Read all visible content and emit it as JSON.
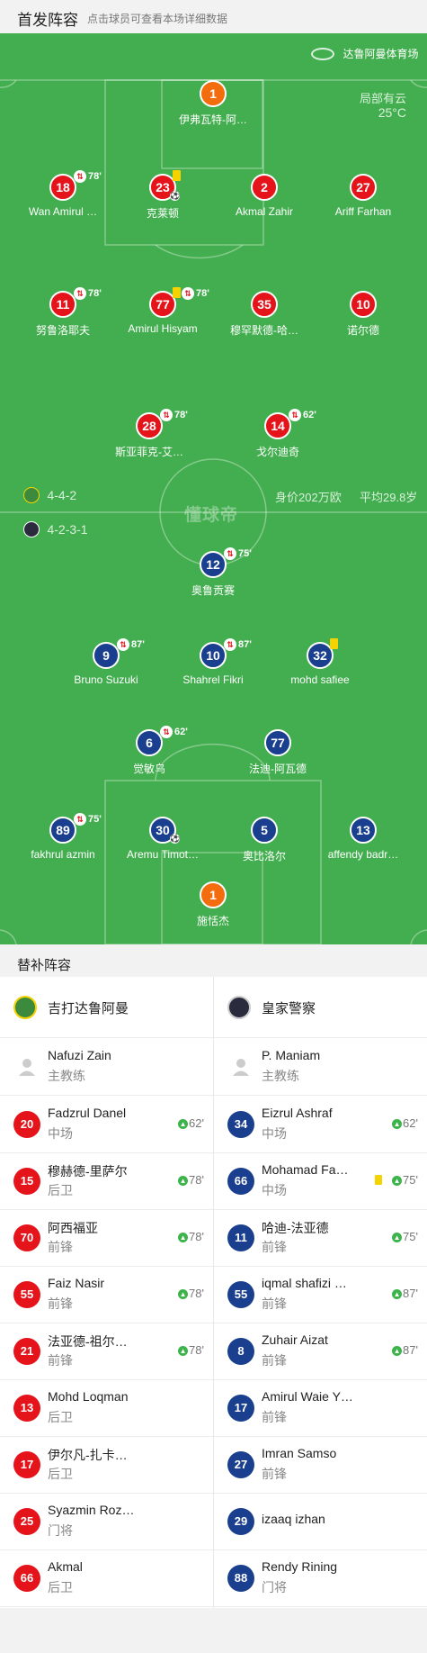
{
  "header": {
    "title": "首发阵容",
    "subtitle": "点击球员可查看本场详细数据"
  },
  "pitch": {
    "stadium": "达鲁阿曼体育场",
    "weather": "局部有云",
    "temperature": "25°C",
    "watermark": "懂球帝",
    "home_formation": "4-4-2",
    "away_formation": "4-2-3-1",
    "market_value": "身价202万欧",
    "avg_age": "平均29.8岁"
  },
  "home_lineup": [
    {
      "number": "1",
      "name": "伊弗瓦特-阿…",
      "role": "gk",
      "sub": "",
      "ycard": false,
      "goal": false
    },
    {
      "number": "18",
      "name": "Wan Amirul …",
      "role": "field",
      "sub": "78'",
      "ycard": false,
      "goal": false
    },
    {
      "number": "23",
      "name": "克莱顿",
      "role": "field",
      "sub": "",
      "ycard": true,
      "goal": true
    },
    {
      "number": "2",
      "name": "Akmal Zahir",
      "role": "field",
      "sub": "",
      "ycard": false,
      "goal": false
    },
    {
      "number": "27",
      "name": "Ariff Farhan",
      "role": "field",
      "sub": "",
      "ycard": false,
      "goal": false
    },
    {
      "number": "11",
      "name": "努鲁洛耶夫",
      "role": "field",
      "sub": "78'",
      "ycard": false,
      "goal": false
    },
    {
      "number": "77",
      "name": "Amirul Hisyam",
      "role": "field",
      "sub": "78'",
      "ycard": true,
      "goal": false
    },
    {
      "number": "35",
      "name": "穆罕默德-哈…",
      "role": "field",
      "sub": "",
      "ycard": false,
      "goal": false
    },
    {
      "number": "10",
      "name": "诺尔德",
      "role": "field",
      "sub": "",
      "ycard": false,
      "goal": false
    },
    {
      "number": "28",
      "name": "斯亚菲克-艾…",
      "role": "field",
      "sub": "78'",
      "ycard": false,
      "goal": false
    },
    {
      "number": "14",
      "name": "戈尔迪奇",
      "role": "field",
      "sub": "62'",
      "ycard": false,
      "goal": false
    }
  ],
  "away_lineup": [
    {
      "number": "12",
      "name": "奥鲁贡赛",
      "role": "field",
      "sub": "75'",
      "ycard": false,
      "goal": false
    },
    {
      "number": "9",
      "name": "Bruno Suzuki",
      "role": "field",
      "sub": "87'",
      "ycard": false,
      "goal": false
    },
    {
      "number": "10",
      "name": "Shahrel Fikri",
      "role": "field",
      "sub": "87'",
      "ycard": false,
      "goal": false
    },
    {
      "number": "32",
      "name": "mohd safiee",
      "role": "field",
      "sub": "",
      "ycard": true,
      "goal": false
    },
    {
      "number": "6",
      "name": "觉敏乌",
      "role": "field",
      "sub": "62'",
      "ycard": false,
      "goal": false
    },
    {
      "number": "77",
      "name": "法迪-阿瓦德",
      "role": "field",
      "sub": "",
      "ycard": false,
      "goal": false
    },
    {
      "number": "89",
      "name": "fakhrul azmin",
      "role": "field",
      "sub": "75'",
      "ycard": false,
      "goal": false
    },
    {
      "number": "30",
      "name": "Aremu Timot…",
      "role": "field",
      "sub": "",
      "ycard": false,
      "goal": true
    },
    {
      "number": "5",
      "name": "奥比洛尔",
      "role": "field",
      "sub": "",
      "ycard": false,
      "goal": false
    },
    {
      "number": "13",
      "name": "affendy badr…",
      "role": "field",
      "sub": "",
      "ycard": false,
      "goal": false
    },
    {
      "number": "1",
      "name": "施恬杰",
      "role": "gk",
      "sub": "",
      "ycard": false,
      "goal": false
    }
  ],
  "subs_section": {
    "title": "替补阵容"
  },
  "home_subs": {
    "team": "吉打达鲁阿曼",
    "coach": {
      "name": "Nafuzi Zain",
      "role": "主教练"
    },
    "players": [
      {
        "number": "20",
        "name": "Fadzrul Danel",
        "pos": "中场",
        "in": "62'",
        "ycard": false
      },
      {
        "number": "15",
        "name": "穆赫德-里萨尔",
        "pos": "后卫",
        "in": "78'",
        "ycard": false
      },
      {
        "number": "70",
        "name": "阿西福亚",
        "pos": "前锋",
        "in": "78'",
        "ycard": false
      },
      {
        "number": "55",
        "name": "Faiz Nasir",
        "pos": "前锋",
        "in": "78'",
        "ycard": false
      },
      {
        "number": "21",
        "name": "法亚德-祖尔…",
        "pos": "前锋",
        "in": "78'",
        "ycard": false
      },
      {
        "number": "13",
        "name": "Mohd Loqman",
        "pos": "后卫",
        "in": "",
        "ycard": false
      },
      {
        "number": "17",
        "name": "伊尔凡-扎卡…",
        "pos": "后卫",
        "in": "",
        "ycard": false
      },
      {
        "number": "25",
        "name": "Syazmin Roz…",
        "pos": "门将",
        "in": "",
        "ycard": false
      },
      {
        "number": "66",
        "name": "Akmal",
        "pos": "后卫",
        "in": "",
        "ycard": false
      }
    ]
  },
  "away_subs": {
    "team": "皇家警察",
    "coach": {
      "name": "P. Maniam",
      "role": "主教练"
    },
    "players": [
      {
        "number": "34",
        "name": "Eizrul Ashraf",
        "pos": "中场",
        "in": "62'",
        "ycard": false
      },
      {
        "number": "66",
        "name": "Mohamad Fa…",
        "pos": "中场",
        "in": "75'",
        "ycard": true
      },
      {
        "number": "11",
        "name": "哈迪-法亚德",
        "pos": "前锋",
        "in": "75'",
        "ycard": false
      },
      {
        "number": "55",
        "name": "iqmal shafizi …",
        "pos": "前锋",
        "in": "87'",
        "ycard": false
      },
      {
        "number": "8",
        "name": "Zuhair Aizat",
        "pos": "前锋",
        "in": "87'",
        "ycard": false
      },
      {
        "number": "17",
        "name": "Amirul Waie Y…",
        "pos": "前锋",
        "in": "",
        "ycard": false
      },
      {
        "number": "27",
        "name": "Imran Samso",
        "pos": "前锋",
        "in": "",
        "ycard": false
      },
      {
        "number": "29",
        "name": "izaaq izhan",
        "pos": "",
        "in": "",
        "ycard": false
      },
      {
        "number": "88",
        "name": "Rendy Rining",
        "pos": "门将",
        "in": "",
        "ycard": false
      }
    ]
  },
  "colors": {
    "pitch": "#43ae4f",
    "home": "#e5131a",
    "away": "#1b3f8f",
    "gk": "#f36c0e",
    "sub_in": "#3cb44b",
    "yellow_card": "#f5d300"
  }
}
